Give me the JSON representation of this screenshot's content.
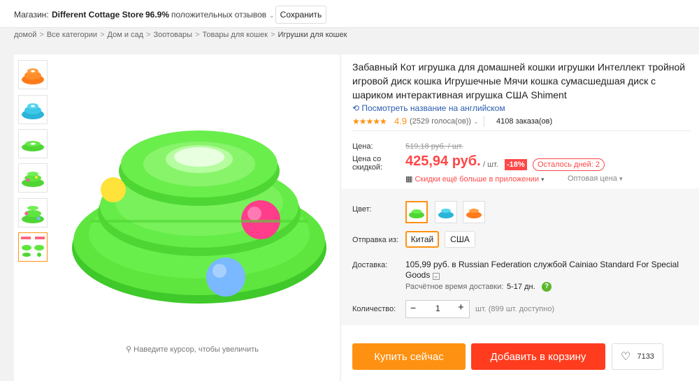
{
  "store": {
    "label": "Магазин:",
    "name": "Different Cottage Store",
    "rating_pct": "96.9%",
    "feedback_label": "положительных отзывов",
    "save_label": "Сохранить"
  },
  "breadcrumbs": [
    "домой",
    "Все категории",
    "Дом и сад",
    "Зоотовары",
    "Товары для кошек",
    "Игрушки для кошек"
  ],
  "gallery": {
    "thumbnails": [
      "orange-tower",
      "blue-tower",
      "green-tower",
      "green-tower-side",
      "green-tower-balls",
      "product-diagram"
    ],
    "zoom_hint": "Наведите курсор, чтобы увеличить"
  },
  "product": {
    "title": "Забавный Кот игрушка для домашней кошки игрушки Интеллект тройной игровой диск кошка Игрушечные Мячи кошка сумасшедшая диск с шариком интерактивная игрушка США Shiment",
    "english_link": "Посмотреть название на английском",
    "rating": "4.9",
    "votes": "(2529 голоса(ов))",
    "orders": "4108 заказа(ов)",
    "stars": 5
  },
  "price": {
    "label": "Цена:",
    "original": "519,18 руб. / шт.",
    "discount_label_1": "Цена со",
    "discount_label_2": "скидкой:",
    "current": "425,94 руб.",
    "unit": "/ шт.",
    "discount_badge": "-18%",
    "days_left": "Осталось дней: 2",
    "app_discount": "Скидки ещё больше в приложении",
    "wholesale": "Оптовая цена"
  },
  "options": {
    "color_label": "Цвет:",
    "colors": [
      "зелёный",
      "голубой",
      "оранжевый"
    ],
    "ship_from_label": "Отправка из:",
    "ship_from": [
      "Китай",
      "США"
    ],
    "delivery_label": "Доставка:",
    "delivery_text_1": "105,99 руб. в Russian Federation службой Cainiao Standard For Special",
    "delivery_text_2": "Goods",
    "eta_label": "Расчётное время доставки:",
    "eta_value": "5-17 дн.",
    "qty_label": "Количество:",
    "qty_minus": "−",
    "qty_value": "1",
    "qty_plus": "+",
    "qty_available": "шт. (899 шт. доступно)"
  },
  "actions": {
    "buy_now": "Купить сейчас",
    "add_to_cart": "Добавить в корзину",
    "wishlist_count": "7133"
  },
  "colors": {
    "accent": "#ff4747",
    "buy": "#ff9112",
    "cart": "#ff3c1e",
    "link": "#2a5db0",
    "toy_green": "#5ee63e",
    "toy_blue": "#3cc8e6",
    "toy_orange": "#ff7a1a"
  }
}
